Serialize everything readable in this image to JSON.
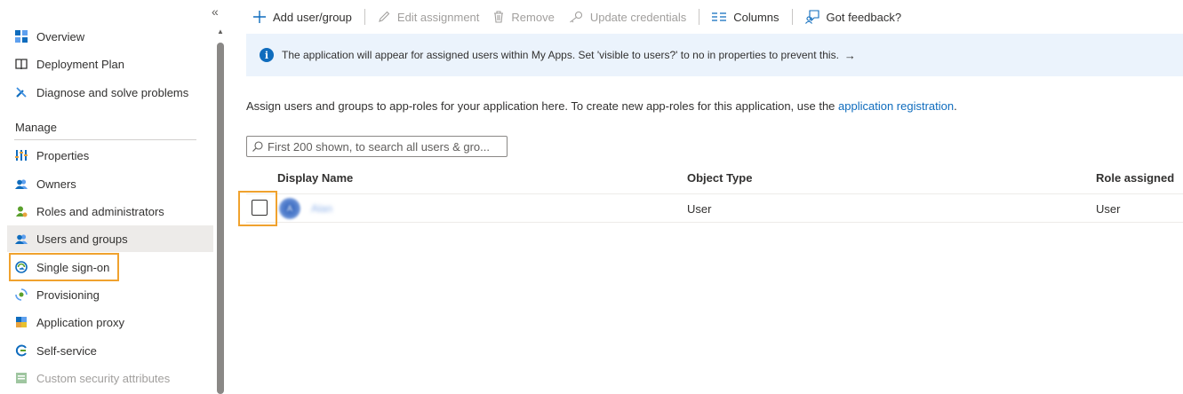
{
  "sidebar": {
    "collapse_glyph": "«",
    "items_top": [
      {
        "label": "Overview",
        "icon": "overview-icon"
      },
      {
        "label": "Deployment Plan",
        "icon": "book-icon"
      },
      {
        "label": "Diagnose and solve problems",
        "icon": "wrench-icon"
      }
    ],
    "section_manage": "Manage",
    "items_manage": [
      {
        "label": "Properties",
        "icon": "properties-icon"
      },
      {
        "label": "Owners",
        "icon": "owners-icon"
      },
      {
        "label": "Roles and administrators",
        "icon": "roles-icon"
      },
      {
        "label": "Users and groups",
        "icon": "users-groups-icon",
        "selected": true
      },
      {
        "label": "Single sign-on",
        "icon": "sso-icon"
      },
      {
        "label": "Provisioning",
        "icon": "provisioning-icon"
      },
      {
        "label": "Application proxy",
        "icon": "app-proxy-icon"
      },
      {
        "label": "Self-service",
        "icon": "self-service-icon"
      },
      {
        "label": "Custom security attributes",
        "icon": "custom-attributes-icon",
        "disabled": true
      }
    ]
  },
  "toolbar": {
    "add": "Add user/group",
    "edit": "Edit assignment",
    "remove": "Remove",
    "update": "Update credentials",
    "columns": "Columns",
    "feedback": "Got feedback?"
  },
  "banner": {
    "text": "The application will appear for assigned users within My Apps. Set 'visible to users?' to no in properties to prevent this.",
    "arrow": "→"
  },
  "description": {
    "text": "Assign users and groups to app-roles for your application here. To create new app-roles for this application, use the ",
    "link": "application registration",
    "suffix": "."
  },
  "search": {
    "placeholder": "First 200 shown, to search all users & gro..."
  },
  "table": {
    "columns": [
      "Display Name",
      "Object Type",
      "Role assigned"
    ],
    "rows": [
      {
        "display_name": "Alan",
        "avatar_initial": "A",
        "object_type": "User",
        "role_assigned": "User"
      }
    ]
  },
  "colors": {
    "accent": "#0f6cbd",
    "highlight": "#f0a22e",
    "banner_bg": "#ebf3fc",
    "selected_bg": "#edebe9"
  }
}
